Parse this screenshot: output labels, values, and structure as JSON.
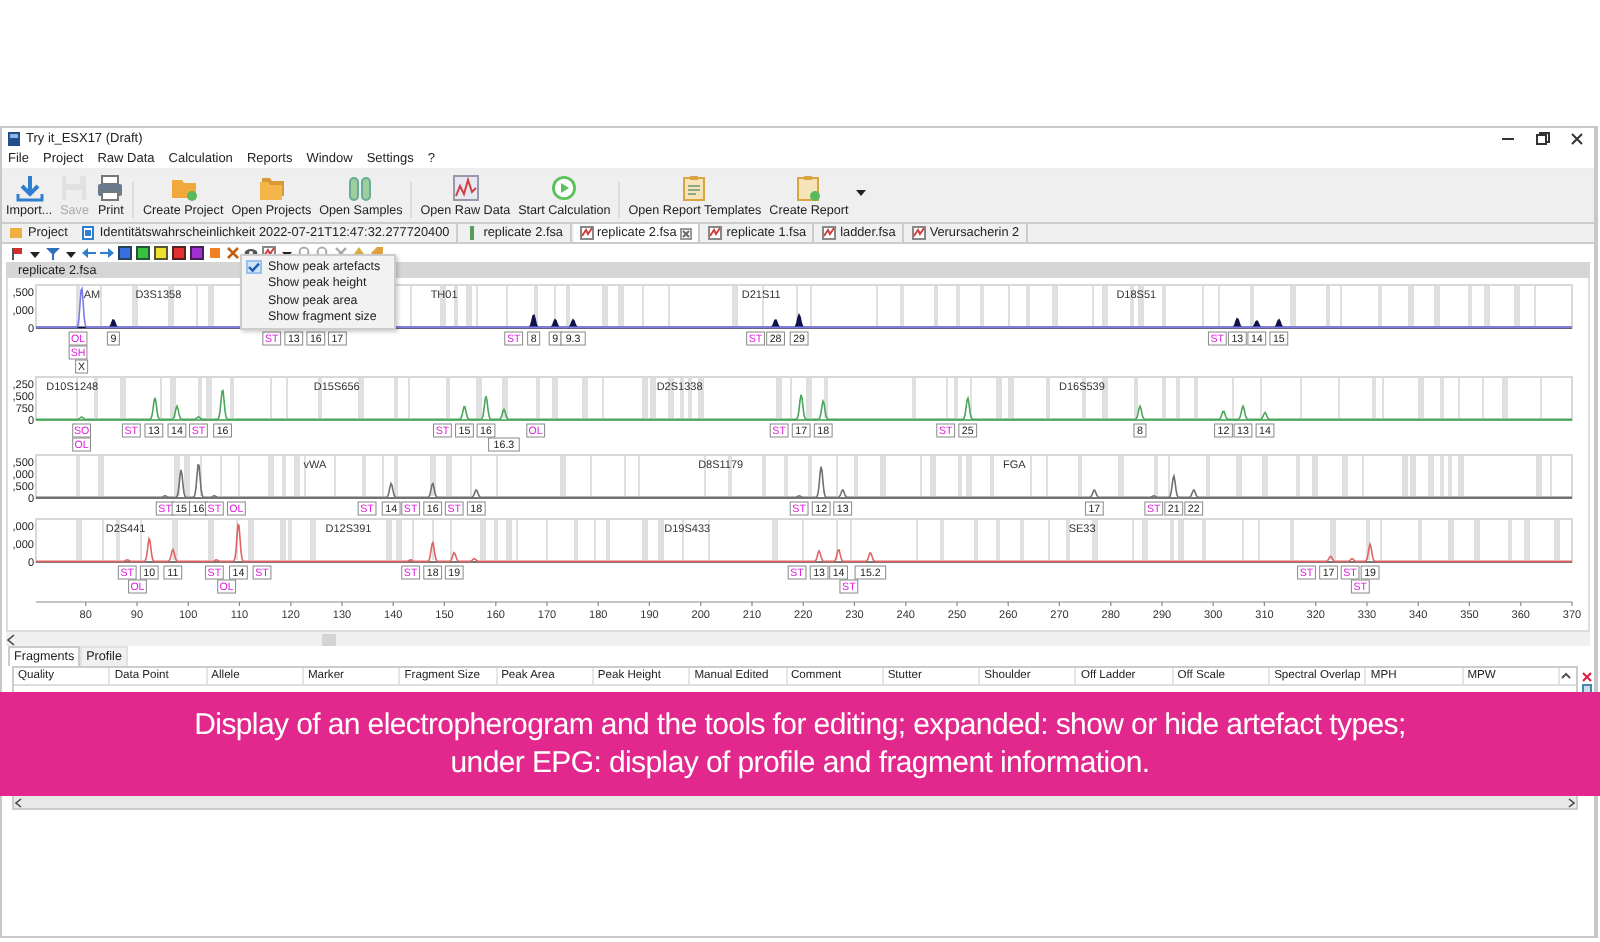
{
  "window": {
    "title": "Try it_ESX17 (Draft)"
  },
  "menu": [
    "File",
    "Project",
    "Raw Data",
    "Calculation",
    "Reports",
    "Window",
    "Settings",
    "?"
  ],
  "toolbar": [
    {
      "label": "Import...",
      "kind": "import",
      "disabled": false
    },
    {
      "label": "Save",
      "kind": "save",
      "disabled": true
    },
    {
      "label": "Print",
      "kind": "print",
      "disabled": false
    },
    {
      "label": "Create Project",
      "kind": "folder",
      "disabled": false
    },
    {
      "label": "Open Projects",
      "kind": "folders",
      "disabled": false
    },
    {
      "label": "Open Samples",
      "kind": "samples",
      "disabled": false
    },
    {
      "label": "Open Raw Data",
      "kind": "rawdata",
      "disabled": false
    },
    {
      "label": "Start Calculation",
      "kind": "start",
      "disabled": false
    },
    {
      "label": "Open Report Templates",
      "kind": "templates",
      "disabled": false
    },
    {
      "label": "Create Report",
      "kind": "report",
      "disabled": false
    }
  ],
  "editor_tabs": [
    {
      "label": "Project",
      "kind": "view",
      "selected": false
    },
    {
      "label": "Identitätswahrscheinlichkeit 2022-07-21T12:47:32.277720400",
      "kind": "calc",
      "selected": false
    },
    {
      "label": "replicate 2.fsa",
      "kind": "file",
      "selected": false
    },
    {
      "label": "replicate 2.fsa",
      "kind": "epg",
      "selected": true
    },
    {
      "label": "replicate 1.fsa",
      "kind": "epg",
      "selected": false
    },
    {
      "label": "ladder.fsa",
      "kind": "epg",
      "selected": false
    },
    {
      "label": "Verursacherin 2",
      "kind": "epg",
      "selected": false
    }
  ],
  "sub_tab": "replicate 2.fsa",
  "artefact_menu": [
    {
      "label": "Show peak artefacts",
      "checked": true
    },
    {
      "label": "Show peak height",
      "checked": false
    },
    {
      "label": "Show peak area",
      "checked": false
    },
    {
      "label": "Show fragment size",
      "checked": false
    }
  ],
  "epg": {
    "panels": [
      {
        "y_labels": [
          ",500",
          ",000",
          "0"
        ],
        "markers": [
          "AM",
          "D3S1358",
          "TH01",
          "D21S11",
          "D18S51"
        ],
        "labels": [
          {
            "text": "OL",
            "kind": "artefact"
          },
          {
            "text": "SH",
            "kind": "artefact"
          },
          {
            "text": "X",
            "kind": "allele"
          },
          {
            "text": "9",
            "kind": "allele"
          },
          {
            "text": "ST",
            "kind": "artefact"
          },
          {
            "text": "13",
            "kind": "allele"
          },
          {
            "text": "16",
            "kind": "allele"
          },
          {
            "text": "17",
            "kind": "allele"
          },
          {
            "text": "ST",
            "kind": "artefact"
          },
          {
            "text": "8",
            "kind": "allele"
          },
          {
            "text": "9",
            "kind": "allele"
          },
          {
            "text": "9.3",
            "kind": "allele"
          },
          {
            "text": "ST",
            "kind": "artefact"
          },
          {
            "text": "28",
            "kind": "allele"
          },
          {
            "text": "29",
            "kind": "allele"
          },
          {
            "text": "ST",
            "kind": "artefact"
          },
          {
            "text": "13",
            "kind": "allele"
          },
          {
            "text": "14",
            "kind": "allele"
          },
          {
            "text": "15",
            "kind": "allele"
          }
        ]
      },
      {
        "y_labels": [
          ",250",
          ",500",
          "750",
          "0"
        ],
        "markers": [
          "D10S1248",
          "D15S656",
          "D2S1338",
          "D16S539"
        ],
        "labels": [
          {
            "text": "SO",
            "kind": "artefact"
          },
          {
            "text": "OL",
            "kind": "artefact"
          },
          {
            "text": "ST",
            "kind": "artefact"
          },
          {
            "text": "13",
            "kind": "allele"
          },
          {
            "text": "14",
            "kind": "allele"
          },
          {
            "text": "ST",
            "kind": "artefact"
          },
          {
            "text": "16",
            "kind": "allele"
          },
          {
            "text": "ST",
            "kind": "artefact"
          },
          {
            "text": "15",
            "kind": "allele"
          },
          {
            "text": "16",
            "kind": "allele"
          },
          {
            "text": "16.3",
            "kind": "allele"
          },
          {
            "text": "OL",
            "kind": "artefact"
          },
          {
            "text": "ST",
            "kind": "artefact"
          },
          {
            "text": "17",
            "kind": "allele"
          },
          {
            "text": "18",
            "kind": "allele"
          },
          {
            "text": "ST",
            "kind": "artefact"
          },
          {
            "text": "25",
            "kind": "allele"
          },
          {
            "text": "8",
            "kind": "allele"
          },
          {
            "text": "12",
            "kind": "allele"
          },
          {
            "text": "13",
            "kind": "allele"
          },
          {
            "text": "14",
            "kind": "allele"
          }
        ]
      },
      {
        "y_labels": [
          ",500",
          ",000",
          ",500",
          "0"
        ],
        "markers": [
          "vWA",
          "D8S1179",
          "FGA"
        ],
        "labels": [
          {
            "text": "ST",
            "kind": "artefact"
          },
          {
            "text": "15",
            "kind": "allele"
          },
          {
            "text": "16",
            "kind": "allele"
          },
          {
            "text": "ST",
            "kind": "artefact"
          },
          {
            "text": "OL",
            "kind": "artefact"
          },
          {
            "text": "ST",
            "kind": "artefact"
          },
          {
            "text": "14",
            "kind": "allele"
          },
          {
            "text": "ST",
            "kind": "artefact"
          },
          {
            "text": "16",
            "kind": "allele"
          },
          {
            "text": "ST",
            "kind": "artefact"
          },
          {
            "text": "18",
            "kind": "allele"
          },
          {
            "text": "ST",
            "kind": "artefact"
          },
          {
            "text": "12",
            "kind": "allele"
          },
          {
            "text": "13",
            "kind": "allele"
          },
          {
            "text": "17",
            "kind": "allele"
          },
          {
            "text": "ST",
            "kind": "artefact"
          },
          {
            "text": "21",
            "kind": "allele"
          },
          {
            "text": "22",
            "kind": "allele"
          }
        ]
      },
      {
        "y_labels": [
          ",000",
          ",000",
          "0"
        ],
        "markers": [
          "D2S441",
          "D12S391",
          "D19S433",
          "SE33"
        ],
        "labels": [
          {
            "text": "ST",
            "kind": "artefact"
          },
          {
            "text": "OL",
            "kind": "artefact"
          },
          {
            "text": "10",
            "kind": "allele"
          },
          {
            "text": "11",
            "kind": "allele"
          },
          {
            "text": "ST",
            "kind": "artefact"
          },
          {
            "text": "OL",
            "kind": "artefact"
          },
          {
            "text": "14",
            "kind": "allele"
          },
          {
            "text": "ST",
            "kind": "artefact"
          },
          {
            "text": "ST",
            "kind": "artefact"
          },
          {
            "text": "18",
            "kind": "allele"
          },
          {
            "text": "19",
            "kind": "allele"
          },
          {
            "text": "ST",
            "kind": "artefact"
          },
          {
            "text": "13",
            "kind": "allele"
          },
          {
            "text": "14",
            "kind": "allele"
          },
          {
            "text": "ST",
            "kind": "artefact"
          },
          {
            "text": "15.2",
            "kind": "allele"
          },
          {
            "text": "ST",
            "kind": "artefact"
          },
          {
            "text": "17",
            "kind": "allele"
          },
          {
            "text": "ST",
            "kind": "artefact"
          },
          {
            "text": "ST",
            "kind": "artefact"
          },
          {
            "text": "19",
            "kind": "allele"
          }
        ]
      }
    ],
    "x_ticks": [
      "80",
      "90",
      "100",
      "110",
      "120",
      "130",
      "140",
      "150",
      "160",
      "170",
      "180",
      "190",
      "200",
      "210",
      "220",
      "230",
      "240",
      "250",
      "260",
      "270",
      "280",
      "290",
      "300",
      "310",
      "320",
      "330",
      "340",
      "350",
      "360",
      "370"
    ]
  },
  "bottom_tabs": [
    {
      "label": "Fragments",
      "selected": true
    },
    {
      "label": "Profile",
      "selected": false
    }
  ],
  "table": {
    "columns": [
      "Quality",
      "Data Point",
      "Allele",
      "Marker",
      "Fragment Size",
      "Peak Area",
      "Peak Height",
      "Manual Edited",
      "Comment",
      "Stutter",
      "Shoulder",
      "Off Ladder",
      "Off Scale",
      "Spectral Overlap",
      "MPH",
      "MPW"
    ]
  },
  "caption": "Display of an electropherogram and the tools for editing; expanded: show or hide artefact types; under EPG: display of profile and fragment information."
}
